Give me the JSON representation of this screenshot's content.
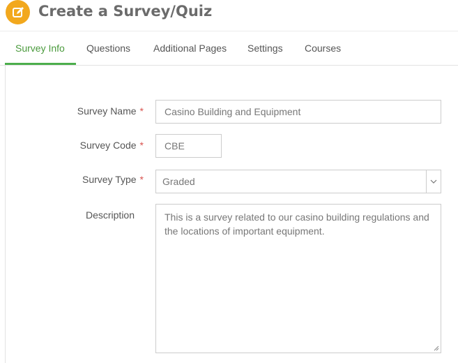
{
  "header": {
    "icon": "edit-icon",
    "title": "Create a Survey/Quiz",
    "icon_color": "#f2a81d"
  },
  "tabs": [
    {
      "label": "Survey Info",
      "active": true
    },
    {
      "label": "Questions",
      "active": false
    },
    {
      "label": "Additional Pages",
      "active": false
    },
    {
      "label": "Settings",
      "active": false
    },
    {
      "label": "Courses",
      "active": false
    }
  ],
  "accent_color": "#4cae4c",
  "required_marker": "*",
  "form": {
    "survey_name": {
      "label": "Survey Name",
      "value": "Casino Building and Equipment"
    },
    "survey_code": {
      "label": "Survey Code",
      "value": "CBE"
    },
    "survey_type": {
      "label": "Survey Type",
      "value": "Graded",
      "icon": "chevron-down-icon"
    },
    "description": {
      "label": "Description",
      "value": "This is a survey related to our casino building regulations and the locations of important equipment."
    }
  }
}
